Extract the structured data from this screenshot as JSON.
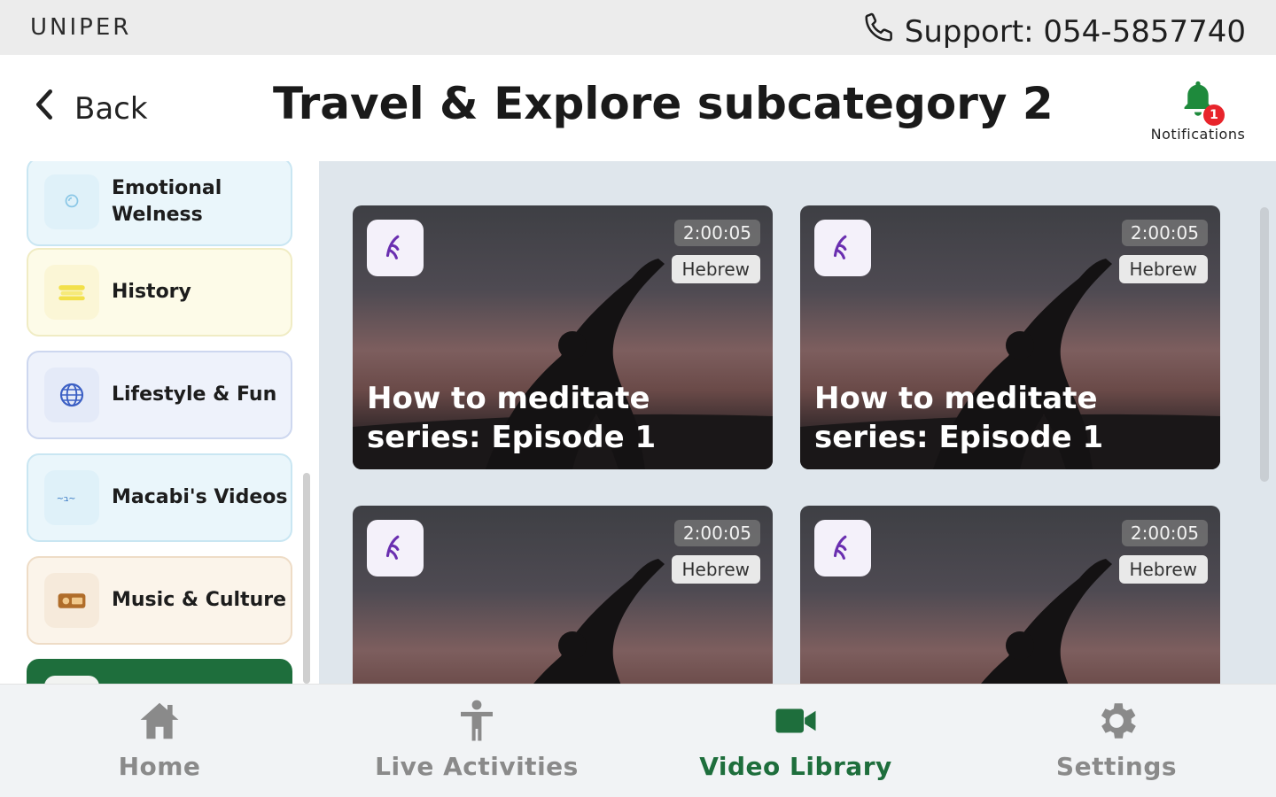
{
  "topbar": {
    "brand": "UNIPER",
    "support": "Support: 054-5857740",
    "phone_icon": "phone-icon"
  },
  "header": {
    "back_label": "Back",
    "title": "Travel & Explore subcategory 2",
    "notifications_label": "Notifications",
    "notifications_count": "1"
  },
  "sidebar": {
    "items": [
      {
        "label_line1": "Emotional",
        "label_line2": "Welness",
        "icon": "head-icon",
        "bg": "#eaf6fb",
        "border": "#c9e6f2"
      },
      {
        "label_line1": "History",
        "label_line2": "",
        "icon": "scroll-icon",
        "bg": "#fdfbe8",
        "border": "#f0ecc4"
      },
      {
        "label_line1": "Lifestyle & Fun",
        "label_line2": "",
        "icon": "globe-icon",
        "bg": "#eef2fb",
        "border": "#cdd7ef"
      },
      {
        "label_line1": "Macabi's Videos",
        "label_line2": "",
        "icon": "macabi-logo-icon",
        "bg": "#eaf6fb",
        "border": "#c9e6f2"
      },
      {
        "label_line1": "Music & Culture",
        "label_line2": "",
        "icon": "radio-icon",
        "bg": "#fbf4ea",
        "border": "#eedcc6"
      },
      {
        "label_line1": "",
        "label_line2": "",
        "icon": "category-icon",
        "bg": "#1e6e3c",
        "border": "#1e6e3c"
      }
    ]
  },
  "videos": [
    {
      "duration": "2:00:05",
      "language": "Hebrew",
      "title": "How to meditate series: Episode 1"
    },
    {
      "duration": "2:00:05",
      "language": "Hebrew",
      "title": "How to meditate series: Episode 1"
    },
    {
      "duration": "2:00:05",
      "language": "Hebrew",
      "title": ""
    },
    {
      "duration": "2:00:05",
      "language": "Hebrew",
      "title": ""
    }
  ],
  "bottomnav": {
    "tabs": [
      {
        "label": "Home",
        "icon": "home-icon",
        "active": false
      },
      {
        "label": "Live Activities",
        "icon": "person-icon",
        "active": false
      },
      {
        "label": "Video Library",
        "icon": "video-camera-icon",
        "active": true
      },
      {
        "label": "Settings",
        "icon": "gear-icon",
        "active": false
      }
    ]
  },
  "colors": {
    "accent_green": "#1e6e3c",
    "notification_badge": "#e8242b",
    "provider_logo_purple": "#6a2fb0"
  }
}
